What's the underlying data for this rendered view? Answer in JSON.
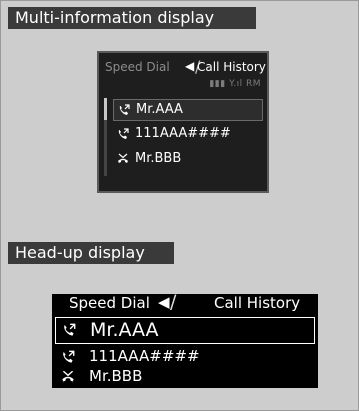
{
  "headings": {
    "mid": "Multi-information display",
    "hud": "Head-up display"
  },
  "tabs": {
    "speed_dial": "Speed Dial",
    "call_history": "Call History",
    "arrow": "◀"
  },
  "status": {
    "indicators": "▮▮▮ Y.ıl RM"
  },
  "calls": [
    {
      "name": "Mr.AAA",
      "type": "outgoing-call-icon",
      "selected": true
    },
    {
      "name": "111AAA####",
      "type": "outgoing-call-icon",
      "selected": false
    },
    {
      "name": "Mr.BBB",
      "type": "missed-call-icon",
      "selected": false
    }
  ]
}
